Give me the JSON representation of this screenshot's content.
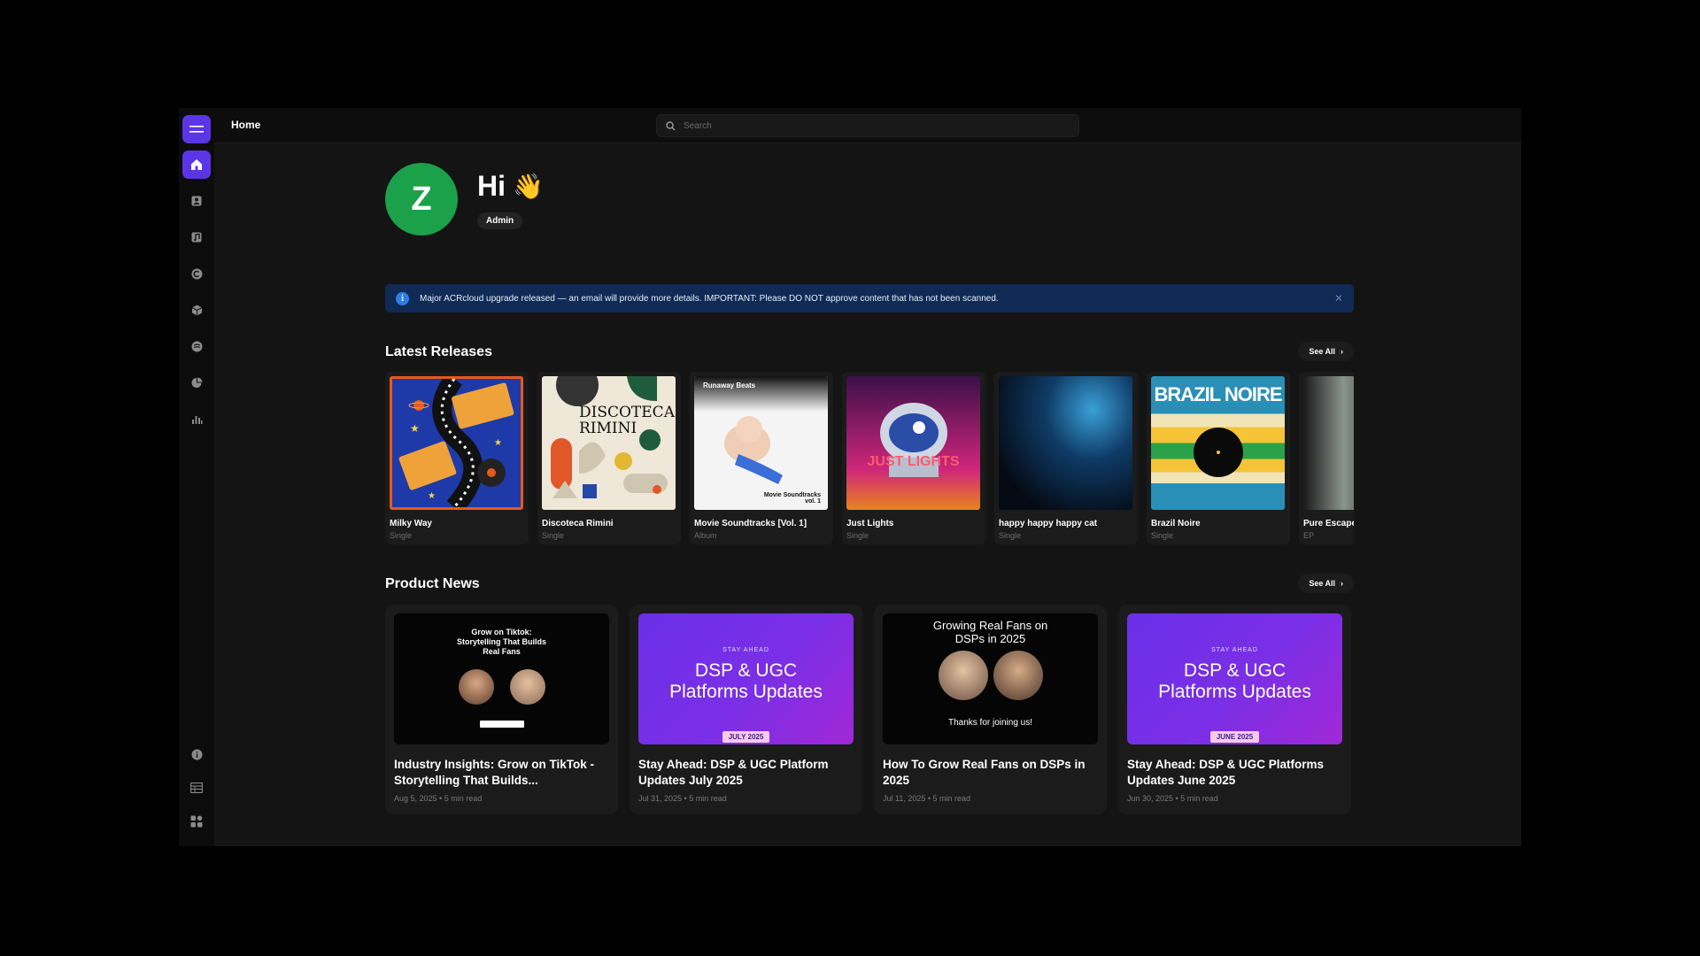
{
  "topbar": {
    "title": "Home",
    "search_placeholder": "Search",
    "user_initial": "Z"
  },
  "profile": {
    "initial": "Z",
    "greeting": "Hi",
    "wave": "👋",
    "role": "Admin"
  },
  "banner": {
    "text": "Major ACRcloud upgrade released — an email will provide more details. IMPORTANT: Please DO NOT approve content that has not been scanned."
  },
  "latest_releases": {
    "title": "Latest Releases",
    "see_all": "See All",
    "items": [
      {
        "name": "Milky Way",
        "type": "Single"
      },
      {
        "name": "Discoteca Rimini",
        "type": "Single",
        "cover_text": "DISCOTECA RIMINI"
      },
      {
        "name": "Movie Soundtracks [Vol. 1]",
        "type": "Album",
        "cover_top": "Runaway Beats",
        "cover_bottom": "Movie Soundtracks vol. 1"
      },
      {
        "name": "Just Lights",
        "type": "Single",
        "cover_text": "JUST LIGHTS"
      },
      {
        "name": "happy happy happy cat",
        "type": "Single"
      },
      {
        "name": "Brazil Noire",
        "type": "Single",
        "cover_text": "BRAZIL NOIRE"
      },
      {
        "name": "Pure Escape",
        "type": "EP"
      }
    ]
  },
  "product_news": {
    "title": "Product News",
    "see_all": "See All",
    "items": [
      {
        "title": "Industry Insights: Grow on TikTok - Storytelling That Builds...",
        "date": "Aug 5, 2025",
        "read": "5 min read",
        "thumb_text": "Grow on Tiktok: Storytelling That Builds Real Fans"
      },
      {
        "title": "Stay Ahead: DSP & UGC Platform Updates July 2025",
        "date": "Jul 31, 2025",
        "read": "5 min read",
        "thumb_kicker": "STAY AHEAD",
        "thumb_head": "DSP & UGC Platforms Updates",
        "thumb_month": "JULY 2025"
      },
      {
        "title": "How To Grow Real Fans on DSPs in 2025",
        "date": "Jul 11, 2025",
        "read": "5 min read",
        "thumb_text": "Growing Real Fans on DSPs in 2025",
        "thumb_footer": "Thanks for joining us!"
      },
      {
        "title": "Stay Ahead: DSP & UGC Platforms Updates June 2025",
        "date": "Jun 30, 2025",
        "read": "5 min read",
        "thumb_kicker": "STAY AHEAD",
        "thumb_head": "DSP & UGC Platforms Updates",
        "thumb_month": "JUNE 2025"
      }
    ]
  },
  "sidebar": {
    "items": [
      {
        "icon": "home-icon"
      },
      {
        "icon": "artists-icon"
      },
      {
        "icon": "music-note-icon"
      },
      {
        "icon": "copyright-icon"
      },
      {
        "icon": "box-icon"
      },
      {
        "icon": "disc-icon"
      },
      {
        "icon": "pie-chart-icon"
      },
      {
        "icon": "bar-chart-icon"
      },
      {
        "icon": "info-icon"
      },
      {
        "icon": "table-icon"
      },
      {
        "icon": "apps-icon"
      }
    ]
  },
  "colors": {
    "accent": "#5b35e8",
    "avatar": "#1aa14a",
    "banner": "#0f2a55"
  }
}
